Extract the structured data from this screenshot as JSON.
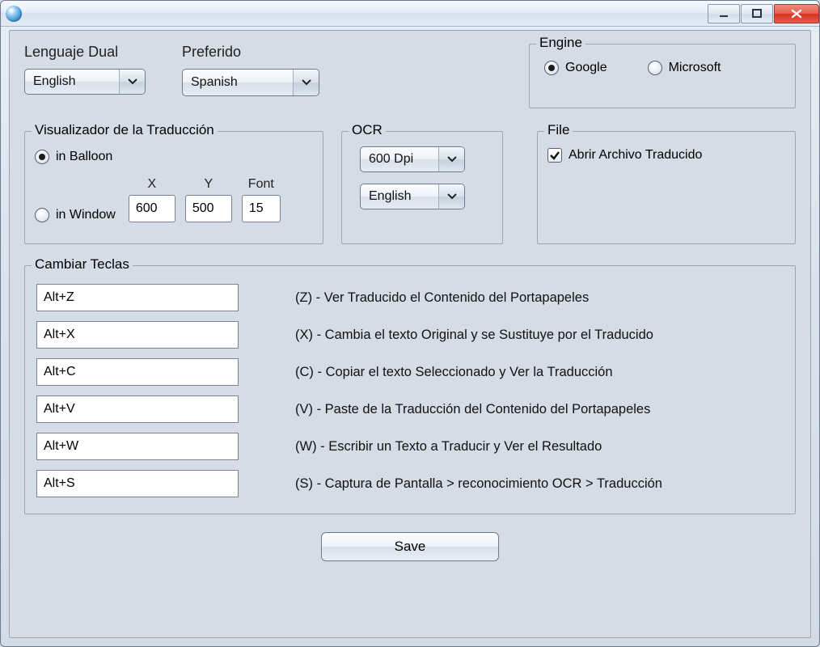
{
  "labels": {
    "lenguaje_dual": "Lenguaje Dual",
    "preferido": "Preferido",
    "engine": "Engine",
    "engine_google": "Google",
    "engine_microsoft": "Microsoft",
    "viewer": "Visualizador de la Traducción",
    "viewer_balloon": "in Balloon",
    "viewer_window": "in Window",
    "x": "X",
    "y": "Y",
    "font": "Font",
    "ocr": "OCR",
    "file": "File",
    "file_open_translated": "Abrir Archivo Traducido",
    "change_keys": "Cambiar Teclas",
    "save": "Save"
  },
  "values": {
    "dual_language": "English",
    "preferred_language": "Spanish",
    "engine_selected": "google",
    "viewer_mode": "balloon",
    "window_x": "600",
    "window_y": "500",
    "window_font": "15",
    "ocr_dpi": "600 Dpi",
    "ocr_language": "English",
    "open_translated_file": true
  },
  "hotkeys": [
    {
      "key": "Alt+Z",
      "desc": "(Z) - Ver Traducido el Contenido del Portapapeles"
    },
    {
      "key": "Alt+X",
      "desc": "(X) - Cambia el texto Original y se Sustituye por el Traducido"
    },
    {
      "key": "Alt+C",
      "desc": "(C) - Copiar el texto Seleccionado y Ver la Traducción"
    },
    {
      "key": "Alt+V",
      "desc": "(V) - Paste de la Traducción del Contenido del Portapapeles"
    },
    {
      "key": "Alt+W",
      "desc": "(W) - Escribir un Texto a Traducir y Ver el Resultado"
    },
    {
      "key": "Alt+S",
      "desc": "(S) - Captura de Pantalla > reconocimiento OCR > Traducción"
    }
  ]
}
